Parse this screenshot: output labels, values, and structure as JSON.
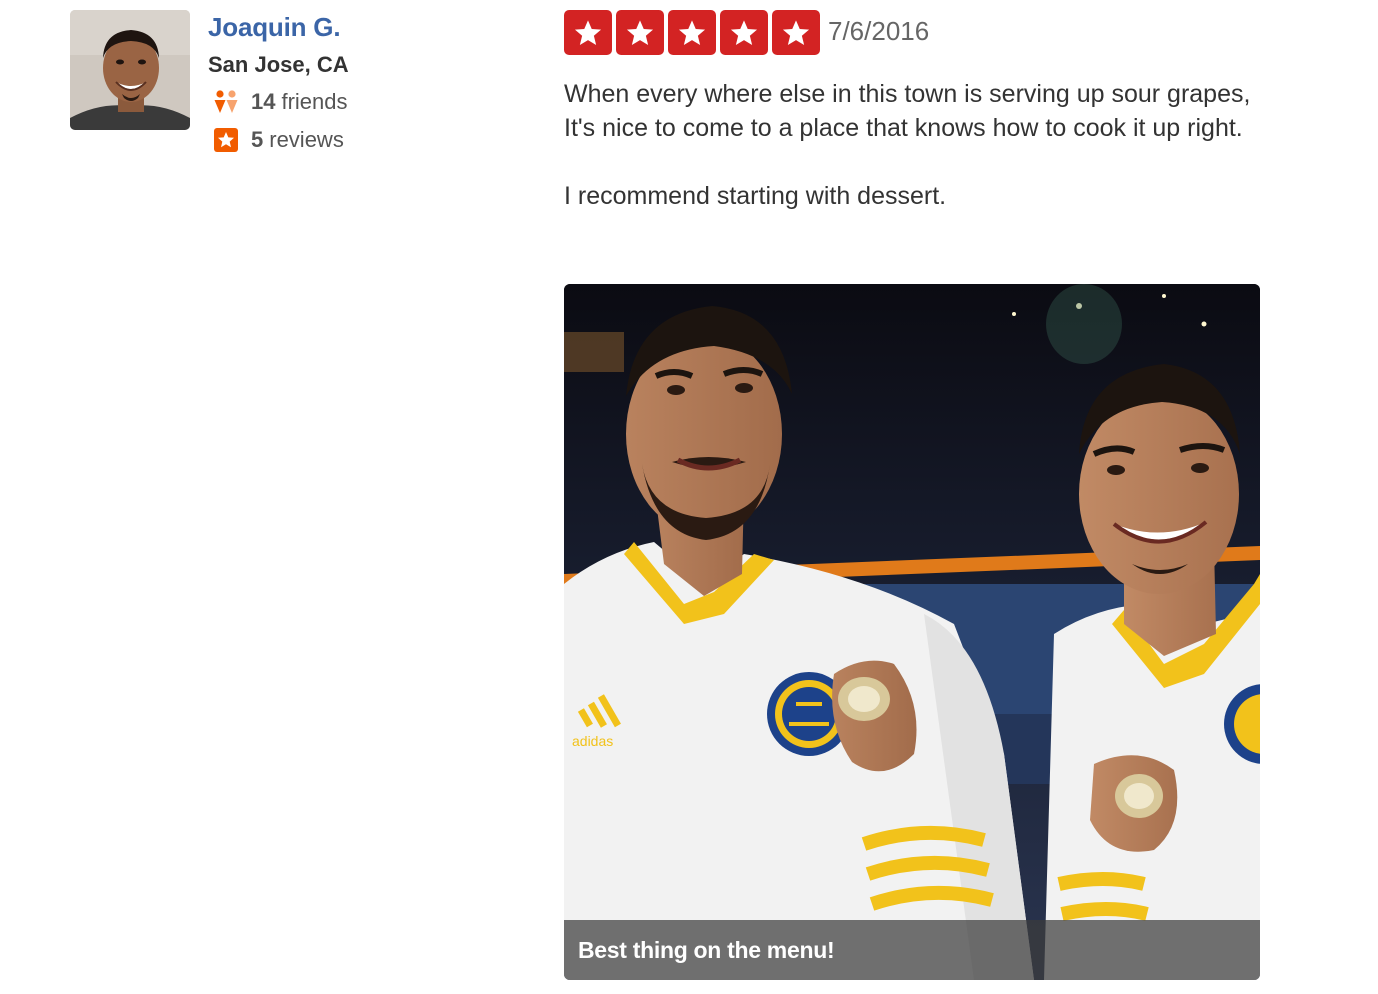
{
  "reviewer": {
    "name": "Joaquin G.",
    "location": "San Jose, CA",
    "friends_count": "14",
    "friends_label": "friends",
    "reviews_count": "5",
    "reviews_label": "reviews"
  },
  "review": {
    "rating": 5,
    "rating_max": 5,
    "date": "7/6/2016",
    "paragraphs": [
      "When every where else in this town is serving up sour grapes,  It's nice to come to a place that knows how to cook it up right.",
      "I recommend starting with dessert."
    ]
  },
  "photo": {
    "caption": "Best thing on the menu!",
    "jersey_brand": "adidas"
  },
  "colors": {
    "star_red": "#d32323",
    "link_blue": "#3b65a7",
    "friends_orange": "#f15c00",
    "reviews_orange": "#f15c00"
  },
  "icons": {
    "friends": "friends-icon",
    "reviews": "star-badge-icon",
    "rating_star": "star-icon"
  }
}
